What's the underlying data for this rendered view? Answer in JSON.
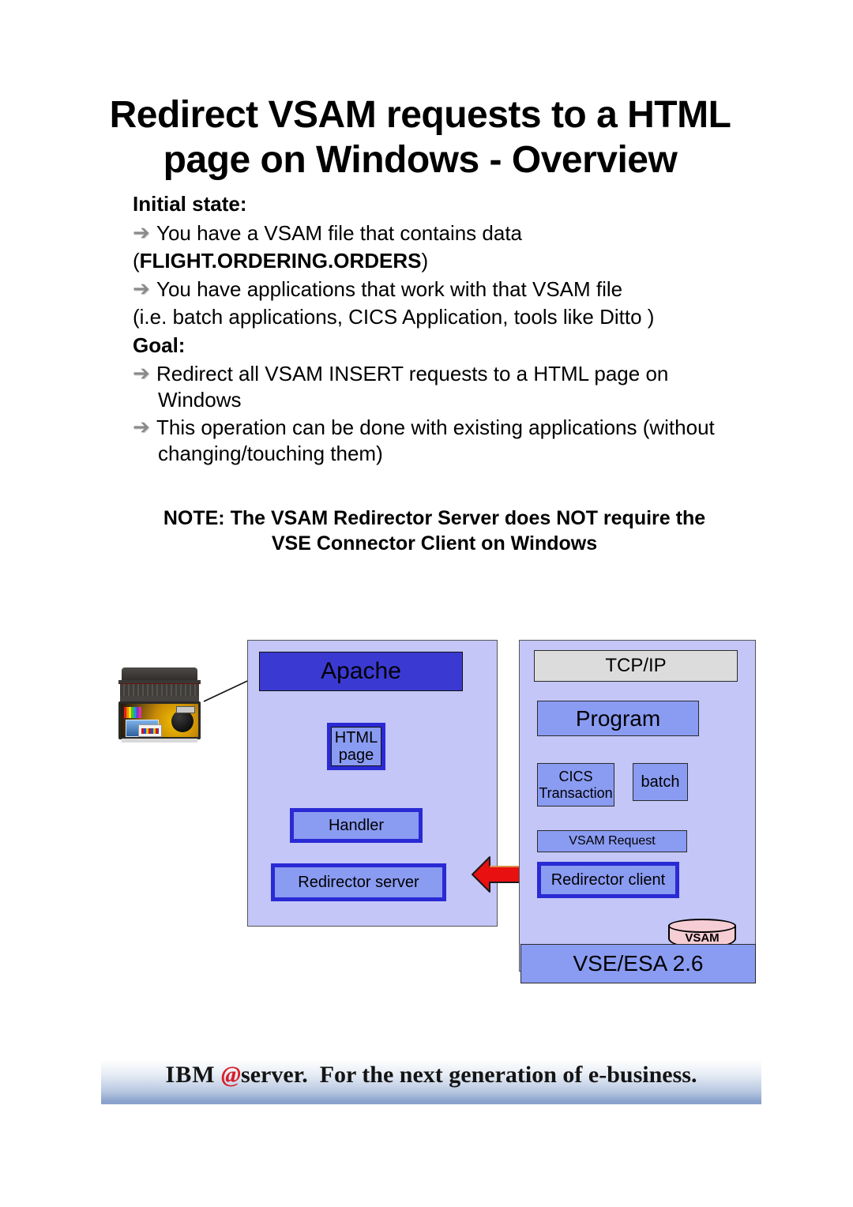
{
  "title": "Redirect VSAM requests to a HTML page on Windows - Overview",
  "sections": {
    "initial": {
      "heading": "Initial state:",
      "bullet1": "You have a VSAM file that contains data",
      "fileline_open": "(",
      "fileline_id": "FLIGHT.ORDERING.ORDERS",
      "fileline_close": ")",
      "bullet2": "You have applications that work with that VSAM file",
      "examples": "(i.e. batch applications, CICS Application, tools like Ditto )"
    },
    "goal": {
      "heading": "Goal:",
      "bullet1_line1": "Redirect all VSAM INSERT requests to a HTML page on",
      "bullet1_line2": "Windows",
      "bullet2_line1": "This operation can be done with existing applications (without",
      "bullet2_line2": "changing/touching them)"
    },
    "note": {
      "line1": "NOTE: The VSAM Redirector Server does NOT require the",
      "line2": "VSE Connector Client on Windows"
    }
  },
  "bullet_glyph": "➔",
  "diagram": {
    "windows_panel": {
      "apache": "Apache",
      "html_page_line1": "HTML",
      "html_page_line2": "page",
      "handler": "Handler",
      "redirector_server": "Redirector server"
    },
    "vse_panel": {
      "tcpip": "TCP/IP",
      "program": "Program",
      "cics_line1": "CICS",
      "cics_line2": "Transaction",
      "batch": "batch",
      "vsam_request": "VSAM Request",
      "redirector_client": "Redirector client",
      "vsam_store": "VSAM",
      "platform": "VSE/ESA 2.6"
    },
    "connector": "double-headed-red-arrow",
    "client_device": "laptop-computer"
  },
  "footer": {
    "brand": "IBM",
    "eglyph": "@",
    "server_word": "server.",
    "tagline": "For the next generation of e-business."
  },
  "colors": {
    "panel_fill": "#c3c6f7",
    "node_fill": "#8a9bf2",
    "apache_fill": "#3a3ad2",
    "thick_border": "#2a2ad4",
    "tcpip_fill": "#dcdcdc",
    "vsam_fill": "#f7cdd4",
    "arrow_red": "#e81010",
    "footer_blue": "#8aa3cc",
    "bullet_gray": "#8a8a8a"
  }
}
